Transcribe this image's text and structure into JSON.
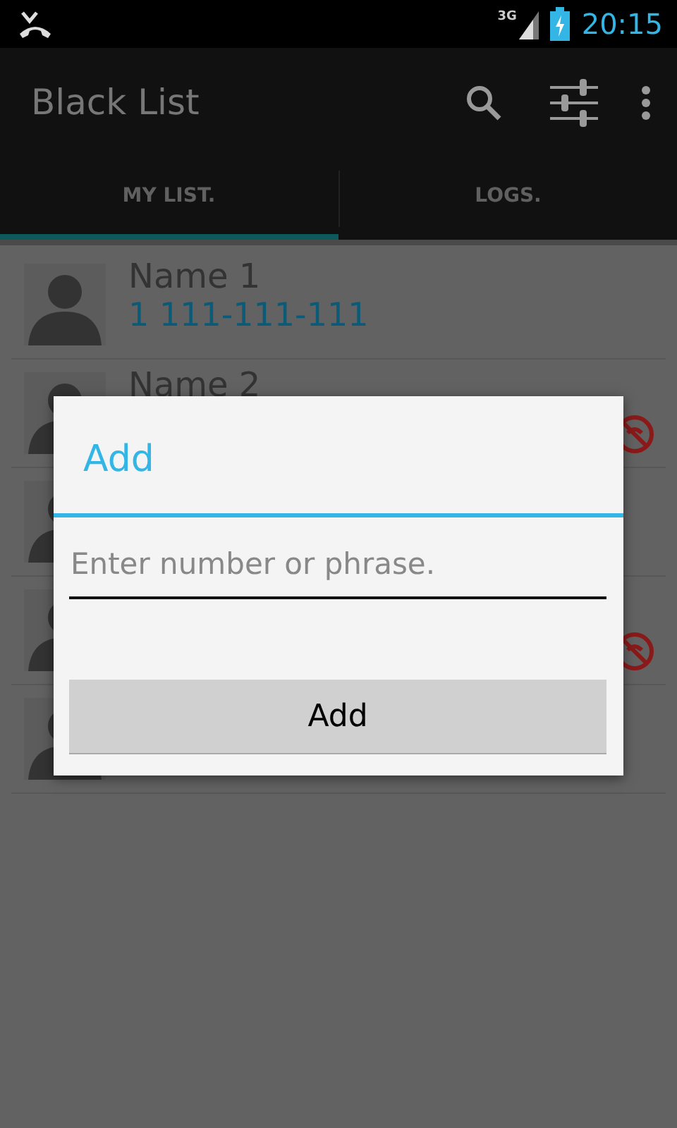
{
  "status_bar": {
    "network": "3G",
    "time": "20:15"
  },
  "action_bar": {
    "title": "Black List"
  },
  "tabs": [
    {
      "label": "MY LIST.",
      "selected": true
    },
    {
      "label": "LOGS.",
      "selected": false
    }
  ],
  "contacts": [
    {
      "name": "Name 1",
      "number": "1 111-111-111",
      "blocked": false
    },
    {
      "name": "Name 2",
      "blocked": true
    },
    {
      "blocked": false
    },
    {
      "blocked": true
    },
    {
      "blocked": false
    }
  ],
  "dialog": {
    "title": "Add",
    "input": {
      "placeholder": "Enter number or phrase."
    },
    "button": "Add"
  }
}
